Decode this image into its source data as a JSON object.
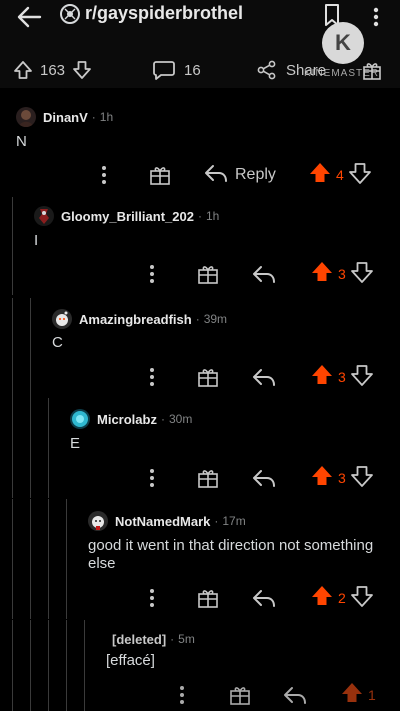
{
  "header": {
    "subreddit": "r/gayspiderbrothel",
    "watermark_letter": "K",
    "watermark_text": "KINEMASTER"
  },
  "post_stats": {
    "score": "163",
    "comments": "16",
    "share_label": "Share"
  },
  "comments": [
    {
      "username": "DinanV",
      "time": "1h",
      "body": "N",
      "votes": "4",
      "reply_label": "Reply"
    },
    {
      "username": "Gloomy_Brilliant_202",
      "time": "1h",
      "body": "I",
      "votes": "3"
    },
    {
      "username": "Amazingbreadfish",
      "time": "39m",
      "body": "C",
      "votes": "3"
    },
    {
      "username": "Microlabz",
      "time": "30m",
      "body": "E",
      "votes": "3"
    },
    {
      "username": "NotNamedMark",
      "time": "17m",
      "body": "good it went in that direction not something else",
      "votes": "2"
    },
    {
      "username": "[deleted]",
      "time": "5m",
      "body": "[effacé]",
      "votes": "1"
    }
  ],
  "colors": {
    "upvote": "#ff4500",
    "background": "#000000",
    "text": "#d7dadc"
  }
}
